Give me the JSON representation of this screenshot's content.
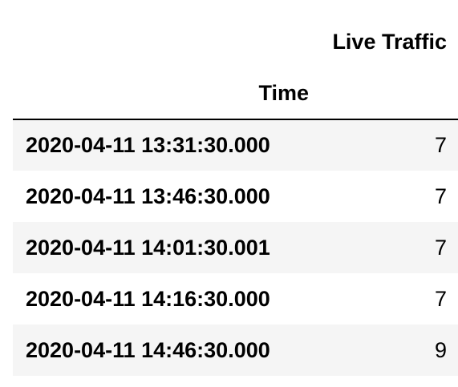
{
  "table": {
    "columns": [
      "Live Traffic"
    ],
    "index_name": "Time",
    "rows": [
      {
        "index": "2020-04-11 13:31:30.000",
        "value": "7"
      },
      {
        "index": "2020-04-11 13:46:30.000",
        "value": "7"
      },
      {
        "index": "2020-04-11 14:01:30.001",
        "value": "7"
      },
      {
        "index": "2020-04-11 14:16:30.000",
        "value": "7"
      },
      {
        "index": "2020-04-11 14:46:30.000",
        "value": "9"
      }
    ]
  },
  "colors": {
    "stripe": "#f5f5f5",
    "background": "#ffffff",
    "text": "#000000",
    "header_rule": "#000000"
  }
}
